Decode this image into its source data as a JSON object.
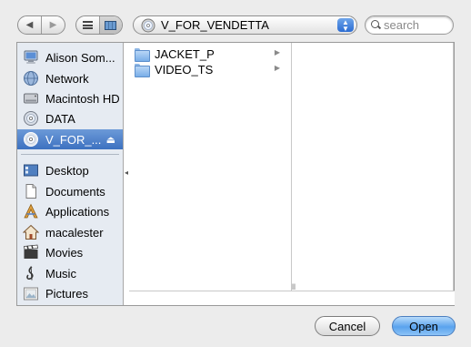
{
  "toolbar": {
    "back_icon": "back-arrow-icon",
    "forward_icon": "forward-arrow-icon",
    "list_view_icon": "list-view-icon",
    "column_view_icon": "column-view-icon",
    "location": "V_FOR_VENDETTA",
    "location_icon": "dvd-disc-icon",
    "search_placeholder": "search"
  },
  "sidebar": {
    "devices": [
      {
        "label": "Alison Som...",
        "icon": "computer-icon"
      },
      {
        "label": "Network",
        "icon": "network-globe-icon"
      },
      {
        "label": "Macintosh HD",
        "icon": "hard-drive-icon"
      },
      {
        "label": "DATA",
        "icon": "disc-icon"
      },
      {
        "label": "V_FOR_...",
        "icon": "dvd-disc-icon",
        "selected": true,
        "eject": "⏏"
      }
    ],
    "places": [
      {
        "label": "Desktop",
        "icon": "desktop-icon"
      },
      {
        "label": "Documents",
        "icon": "documents-icon"
      },
      {
        "label": "Applications",
        "icon": "applications-icon"
      },
      {
        "label": "macalester",
        "icon": "home-icon"
      },
      {
        "label": "Movies",
        "icon": "movies-icon"
      },
      {
        "label": "Music",
        "icon": "music-icon"
      },
      {
        "label": "Pictures",
        "icon": "pictures-icon"
      }
    ]
  },
  "browser": {
    "column1": [
      {
        "name": "JACKET_P",
        "icon": "folder-icon",
        "has_children": true
      },
      {
        "name": "VIDEO_TS",
        "icon": "folder-icon",
        "has_children": true
      }
    ]
  },
  "buttons": {
    "cancel": "Cancel",
    "open": "Open"
  },
  "colors": {
    "selection": "#3d71c0",
    "sidebar_bg": "#e6ebf2",
    "window_bg": "#ececec",
    "default_button": "#5aa3ee"
  }
}
